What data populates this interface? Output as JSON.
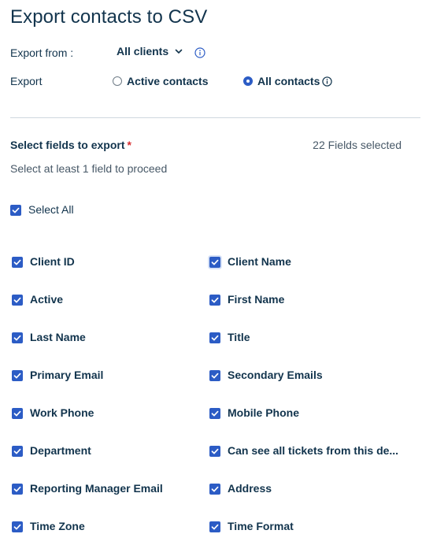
{
  "title": "Export contacts to CSV",
  "export_from": {
    "label": "Export from :",
    "value": "All clients"
  },
  "export": {
    "label": "Export",
    "options": [
      {
        "label": "Active contacts",
        "selected": false
      },
      {
        "label": "All contacts",
        "selected": true
      }
    ]
  },
  "fields_section": {
    "title": "Select fields to export",
    "required_mark": "*",
    "selected_count": "22 Fields selected",
    "hint": "Select at least 1 field to proceed",
    "select_all_label": "Select All",
    "fields": [
      {
        "label": "Client ID",
        "checked": true
      },
      {
        "label": "Client Name",
        "checked": true
      },
      {
        "label": "Active",
        "checked": true
      },
      {
        "label": "First Name",
        "checked": true
      },
      {
        "label": "Last Name",
        "checked": true
      },
      {
        "label": "Title",
        "checked": true
      },
      {
        "label": "Primary Email",
        "checked": true
      },
      {
        "label": "Secondary Emails",
        "checked": true
      },
      {
        "label": "Work Phone",
        "checked": true
      },
      {
        "label": "Mobile Phone",
        "checked": true
      },
      {
        "label": "Department",
        "checked": true
      },
      {
        "label": "Can see all tickets from this de...",
        "checked": true
      },
      {
        "label": "Reporting Manager Email",
        "checked": true
      },
      {
        "label": "Address",
        "checked": true
      },
      {
        "label": "Time Zone",
        "checked": true
      },
      {
        "label": "Time Format",
        "checked": true
      }
    ]
  },
  "colors": {
    "accent": "#2c5cc5",
    "text": "#12344d",
    "muted": "#475867",
    "required": "#d72d30",
    "divider": "#cfd7df"
  }
}
